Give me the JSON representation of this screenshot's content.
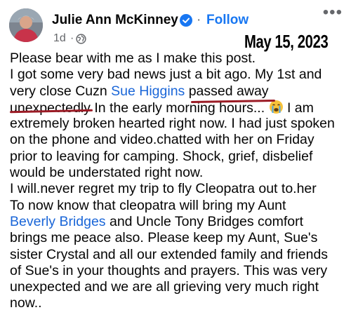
{
  "header": {
    "author": "Julie Ann McKinney",
    "separator": "·",
    "follow_label": "Follow",
    "time": "1d",
    "time_separator": "·",
    "more_label": "•••",
    "annotation_date": "May 15, 2023",
    "avatar_icon": "profile-photo",
    "verified_icon": "verified-badge-icon",
    "globe_icon": "globe-icon"
  },
  "post": {
    "lines": [
      [
        "Please bear with me as I make this post."
      ],
      [
        "I got some very bad news just a bit ago. My 1st and"
      ],
      [
        "very close Cuzn ",
        "Sue Higgins",
        "  passed  away"
      ],
      [
        "unexpectedly",
        " In the early morning hours... ",
        " I am"
      ],
      [
        "extremely broken hearted right now. I had just spoken"
      ],
      [
        "on the phone and video.chatted with her on Friday"
      ],
      [
        "prior to leaving for camping.  Shock, grief, disbelief"
      ],
      [
        "would be understated right now."
      ],
      [
        "I will.never regret my trip to fly Cleopatra out to.her"
      ],
      [
        " To now know that cleopatra will bring my Aunt"
      ],
      [
        "Beverly Bridges",
        " and Uncle Tony Bridges comfort"
      ],
      [
        "brings me peace also. Please keep my Aunt, Sue's"
      ],
      [
        "sister Crystal and all our extended family and friends"
      ],
      [
        "of Sue's in your thoughts and prayers. This was very"
      ],
      [
        "unexpected and we are all grieving very much right"
      ],
      [
        "now.."
      ]
    ],
    "emoji_icon": "crying-face-emoji",
    "colors": {
      "link": "#1a66d8",
      "underline": "#9b1b25",
      "follow": "#1877f2"
    }
  }
}
